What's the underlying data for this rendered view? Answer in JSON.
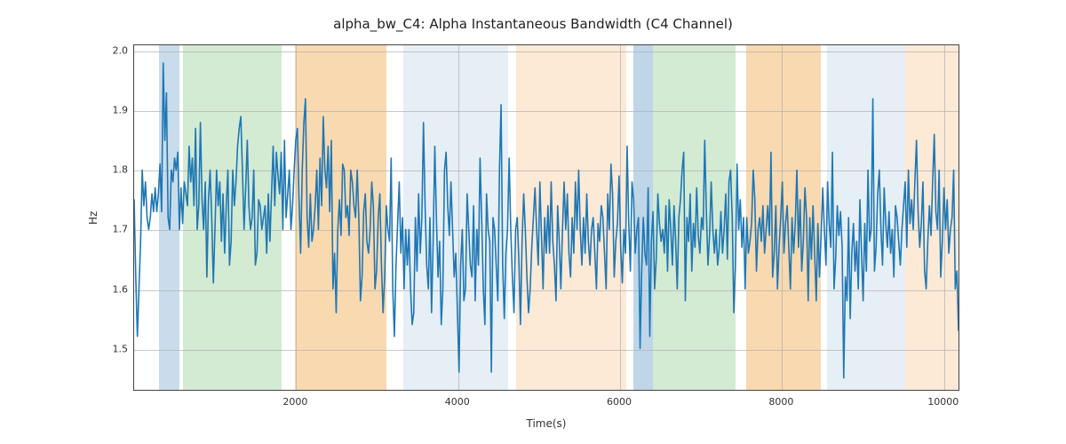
{
  "chart_data": {
    "type": "line",
    "title": "alpha_bw_C4: Alpha Instantaneous Bandwidth (C4 Channel)",
    "xlabel": "Time(s)",
    "ylabel": "Hz",
    "xlim": [
      0,
      10200
    ],
    "ylim": [
      1.43,
      2.01
    ],
    "yticks": [
      1.5,
      1.6,
      1.7,
      1.8,
      1.9,
      2.0
    ],
    "xticks": [
      2000,
      4000,
      6000,
      8000,
      10000
    ],
    "grid": true,
    "bands": [
      {
        "start": 310,
        "end": 560,
        "color": "#b2cde3",
        "alpha": 0.7
      },
      {
        "start": 600,
        "end": 1820,
        "color": "#c1e1c1",
        "alpha": 0.7
      },
      {
        "start": 1980,
        "end": 3120,
        "color": "#f6c98f",
        "alpha": 0.7
      },
      {
        "start": 3320,
        "end": 4620,
        "color": "#d6e4ef",
        "alpha": 0.6
      },
      {
        "start": 4720,
        "end": 6080,
        "color": "#fbe0c4",
        "alpha": 0.7
      },
      {
        "start": 6160,
        "end": 6400,
        "color": "#a9c8e0",
        "alpha": 0.75
      },
      {
        "start": 6400,
        "end": 7420,
        "color": "#c1e1c1",
        "alpha": 0.7
      },
      {
        "start": 7560,
        "end": 8480,
        "color": "#f6c98f",
        "alpha": 0.7
      },
      {
        "start": 8560,
        "end": 9520,
        "color": "#d6e4ef",
        "alpha": 0.6
      },
      {
        "start": 9520,
        "end": 10200,
        "color": "#fbe0c4",
        "alpha": 0.7
      }
    ],
    "series": [
      {
        "name": "alpha_bw_C4",
        "color": "#1f77b4",
        "x_step": 20,
        "x_start": 0,
        "y": [
          1.75,
          1.62,
          1.52,
          1.6,
          1.68,
          1.8,
          1.74,
          1.78,
          1.72,
          1.7,
          1.72,
          1.76,
          1.73,
          1.77,
          1.73,
          1.76,
          1.81,
          1.73,
          1.98,
          1.85,
          1.93,
          1.72,
          1.7,
          1.8,
          1.78,
          1.82,
          1.8,
          1.83,
          1.7,
          1.77,
          1.71,
          1.78,
          1.76,
          1.74,
          1.84,
          1.78,
          1.82,
          1.74,
          1.87,
          1.7,
          1.74,
          1.88,
          1.75,
          1.7,
          1.78,
          1.62,
          1.75,
          1.8,
          1.72,
          1.61,
          1.7,
          1.8,
          1.74,
          1.78,
          1.68,
          1.76,
          1.66,
          1.74,
          1.8,
          1.64,
          1.68,
          1.8,
          1.74,
          1.78,
          1.84,
          1.87,
          1.89,
          1.8,
          1.7,
          1.77,
          1.85,
          1.74,
          1.7,
          1.72,
          1.8,
          1.64,
          1.66,
          1.75,
          1.74,
          1.7,
          1.72,
          1.74,
          1.66,
          1.76,
          1.68,
          1.76,
          1.84,
          1.74,
          1.83,
          1.79,
          1.76,
          1.83,
          1.7,
          1.85,
          1.72,
          1.76,
          1.8,
          1.7,
          1.74,
          1.8,
          1.85,
          1.87,
          1.75,
          1.66,
          1.8,
          1.88,
          1.92,
          1.72,
          1.67,
          1.76,
          1.68,
          1.7,
          1.74,
          1.8,
          1.7,
          1.82,
          1.74,
          1.89,
          1.8,
          1.77,
          1.84,
          1.73,
          1.85,
          1.6,
          1.66,
          1.56,
          1.7,
          1.75,
          1.69,
          1.81,
          1.8,
          1.72,
          1.74,
          1.69,
          1.8,
          1.78,
          1.74,
          1.72,
          1.8,
          1.72,
          1.58,
          1.62,
          1.73,
          1.76,
          1.68,
          1.66,
          1.7,
          1.78,
          1.74,
          1.6,
          1.63,
          1.72,
          1.76,
          1.64,
          1.56,
          1.62,
          1.74,
          1.7,
          1.68,
          1.82,
          1.6,
          1.52,
          1.64,
          1.71,
          1.78,
          1.66,
          1.72,
          1.6,
          1.7,
          1.64,
          1.7,
          1.6,
          1.54,
          1.56,
          1.72,
          1.63,
          1.76,
          1.66,
          1.72,
          1.88,
          1.74,
          1.64,
          1.6,
          1.72,
          1.56,
          1.68,
          1.84,
          1.72,
          1.62,
          1.68,
          1.54,
          1.6,
          1.8,
          1.83,
          1.74,
          1.69,
          1.78,
          1.7,
          1.62,
          1.66,
          1.56,
          1.46,
          1.64,
          1.7,
          1.58,
          1.6,
          1.76,
          1.7,
          1.64,
          1.62,
          1.74,
          1.58,
          1.7,
          1.64,
          1.82,
          1.72,
          1.6,
          1.54,
          1.76,
          1.7,
          1.68,
          1.46,
          1.72,
          1.7,
          1.64,
          1.58,
          1.8,
          1.91,
          1.64,
          1.55,
          1.66,
          1.7,
          1.82,
          1.7,
          1.62,
          1.56,
          1.7,
          1.72,
          1.65,
          1.54,
          1.68,
          1.76,
          1.7,
          1.62,
          1.56,
          1.6,
          1.67,
          1.72,
          1.77,
          1.7,
          1.64,
          1.78,
          1.69,
          1.6,
          1.72,
          1.66,
          1.74,
          1.66,
          1.78,
          1.68,
          1.64,
          1.58,
          1.74,
          1.68,
          1.6,
          1.7,
          1.78,
          1.7,
          1.76,
          1.66,
          1.62,
          1.72,
          1.66,
          1.78,
          1.7,
          1.8,
          1.7,
          1.64,
          1.72,
          1.66,
          1.76,
          1.68,
          1.64,
          1.7,
          1.72,
          1.66,
          1.6,
          1.71,
          1.68,
          1.74,
          1.72,
          1.66,
          1.6,
          1.76,
          1.7,
          1.81,
          1.76,
          1.62,
          1.68,
          1.71,
          1.79,
          1.67,
          1.61,
          1.7,
          1.66,
          1.84,
          1.71,
          1.63,
          1.78,
          1.75,
          1.66,
          1.7,
          1.72,
          1.5,
          1.63,
          1.72,
          1.66,
          1.64,
          1.77,
          1.52,
          1.68,
          1.73,
          1.6,
          1.65,
          1.76,
          1.71,
          1.68,
          1.7,
          1.66,
          1.74,
          1.63,
          1.75,
          1.7,
          1.64,
          1.74,
          1.68,
          1.6,
          1.72,
          1.75,
          1.8,
          1.83,
          1.58,
          1.72,
          1.68,
          1.76,
          1.63,
          1.71,
          1.67,
          1.77,
          1.69,
          1.66,
          1.72,
          1.7,
          1.85,
          1.73,
          1.64,
          1.69,
          1.78,
          1.7,
          1.66,
          1.7,
          1.64,
          1.67,
          1.73,
          1.66,
          1.7,
          1.76,
          1.65,
          1.78,
          1.8,
          1.72,
          1.56,
          1.64,
          1.81,
          1.7,
          1.75,
          1.67,
          1.72,
          1.6,
          1.72,
          1.66,
          1.68,
          1.71,
          1.8,
          1.75,
          1.63,
          1.7,
          1.72,
          1.68,
          1.74,
          1.66,
          1.7,
          1.74,
          1.69,
          1.83,
          1.62,
          1.66,
          1.74,
          1.6,
          1.67,
          1.72,
          1.78,
          1.66,
          1.71,
          1.74,
          1.67,
          1.6,
          1.72,
          1.66,
          1.71,
          1.8,
          1.67,
          1.75,
          1.63,
          1.68,
          1.77,
          1.72,
          1.58,
          1.72,
          1.65,
          1.74,
          1.66,
          1.58,
          1.71,
          1.62,
          1.69,
          1.77,
          1.7,
          1.64,
          1.78,
          1.71,
          1.67,
          1.83,
          1.6,
          1.65,
          1.74,
          1.69,
          1.73,
          1.67,
          1.45,
          1.62,
          1.58,
          1.72,
          1.55,
          1.66,
          1.71,
          1.63,
          1.68,
          1.6,
          1.75,
          1.66,
          1.58,
          1.71,
          1.63,
          1.8,
          1.68,
          1.7,
          1.92,
          1.63,
          1.67,
          1.76,
          1.8,
          1.7,
          1.64,
          1.77,
          1.71,
          1.67,
          1.73,
          1.66,
          1.7,
          1.62,
          1.74,
          1.72,
          1.68,
          1.64,
          1.7,
          1.74,
          1.78,
          1.67,
          1.8,
          1.71,
          1.75,
          1.7,
          1.78,
          1.85,
          1.73,
          1.67,
          1.71,
          1.78,
          1.63,
          1.6,
          1.68,
          1.74,
          1.69,
          1.78,
          1.86,
          1.73,
          1.7,
          1.8,
          1.62,
          1.68,
          1.77,
          1.7,
          1.75,
          1.66,
          1.7,
          1.72,
          1.8,
          1.6,
          1.63,
          1.53
        ]
      }
    ]
  }
}
